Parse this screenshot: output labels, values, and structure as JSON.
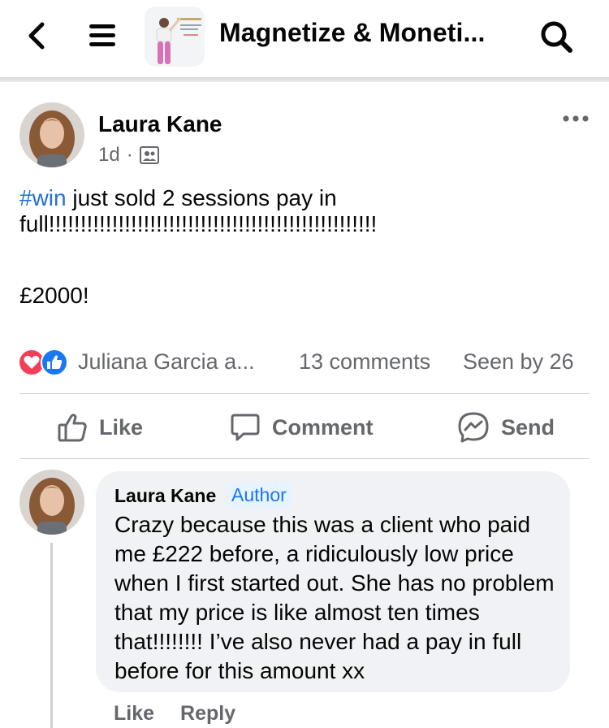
{
  "header": {
    "group_title": "Magnetize & Moneti..."
  },
  "post": {
    "author": "Laura Kane",
    "time": "1d",
    "separator": "·",
    "hashtag": "#win",
    "text": " just sold 2 sessions pay in full!!!!!!!!!!!!!!!!!!!!!!!!!!!!!!!!!!!!!!!!!!!!!!!!!!!!",
    "amount": "£2000!",
    "reactors": "Juliana Garcia a...",
    "comments_count": "13 comments",
    "seen_by": "Seen by 26"
  },
  "actions": {
    "like": "Like",
    "comment": "Comment",
    "send": "Send"
  },
  "comment": {
    "author": "Laura Kane",
    "badge": "Author",
    "text": "Crazy because this was a client who paid me £222 before, a ridiculously low price when I first started out. She has no problem that my price is like almost ten times that!!!!!!!! I’ve also never had a pay in full before for this amount xx",
    "like_label": "Like",
    "reply_label": "Reply"
  },
  "icons": {
    "back": "chevron-left-icon",
    "menu": "hamburger-icon",
    "search": "search-icon",
    "more": "more-horizontal-icon",
    "audience": "group-audience-icon",
    "love": "love-reaction-icon",
    "like": "like-reaction-icon",
    "like_action": "thumbs-up-icon",
    "comment_action": "speech-bubble-icon",
    "send_action": "messenger-icon"
  },
  "colors": {
    "link": "#216fdb",
    "secondary_text": "#65676b",
    "love": "#f33e58",
    "like": "#1877f2",
    "bubble": "#f0f2f5",
    "badge_bg": "#e7f3ff"
  }
}
